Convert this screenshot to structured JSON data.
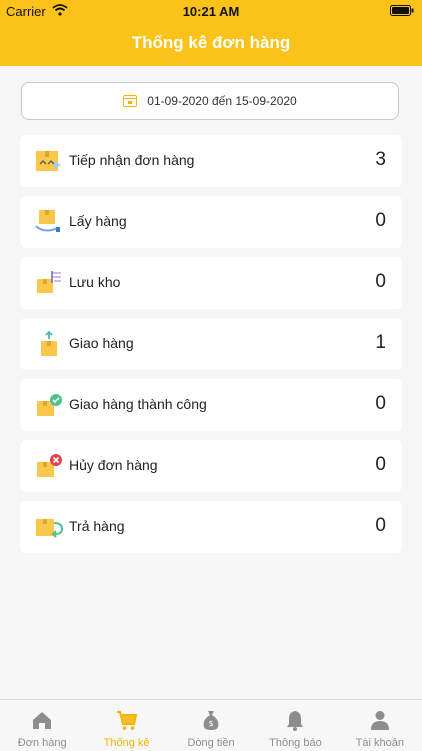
{
  "status": {
    "carrier": "Carrier",
    "time": "10:21 AM"
  },
  "header": {
    "title": "Thống kê đơn hàng"
  },
  "filter": {
    "date_range": "01-09-2020 đến 15-09-2020"
  },
  "stats": [
    {
      "label": "Tiếp nhận đơn hàng",
      "count": "3",
      "icon": "receive-box-icon"
    },
    {
      "label": "Lấy hàng",
      "count": "0",
      "icon": "pickup-box-icon"
    },
    {
      "label": "Lưu kho",
      "count": "0",
      "icon": "warehouse-box-icon"
    },
    {
      "label": "Giao hàng",
      "count": "1",
      "icon": "delivery-box-icon"
    },
    {
      "label": "Giao hàng thành công",
      "count": "0",
      "icon": "delivered-check-icon"
    },
    {
      "label": "Hủy đơn hàng",
      "count": "0",
      "icon": "cancel-order-icon"
    },
    {
      "label": "Trả hàng",
      "count": "0",
      "icon": "return-box-icon"
    }
  ],
  "tabs": [
    {
      "label": "Đơn hàng",
      "icon": "home-icon"
    },
    {
      "label": "Thống kê",
      "icon": "cart-icon",
      "active": true
    },
    {
      "label": "Dòng tiền",
      "icon": "money-bag-icon"
    },
    {
      "label": "Thông báo",
      "icon": "bell-icon"
    },
    {
      "label": "Tài khoản",
      "icon": "user-icon"
    }
  ],
  "colors": {
    "accent": "#fbc21a",
    "active_tab": "#f5b400",
    "inactive_tab": "#8d8d8d",
    "cancel": "#e0434b",
    "success": "#4cc38a"
  }
}
